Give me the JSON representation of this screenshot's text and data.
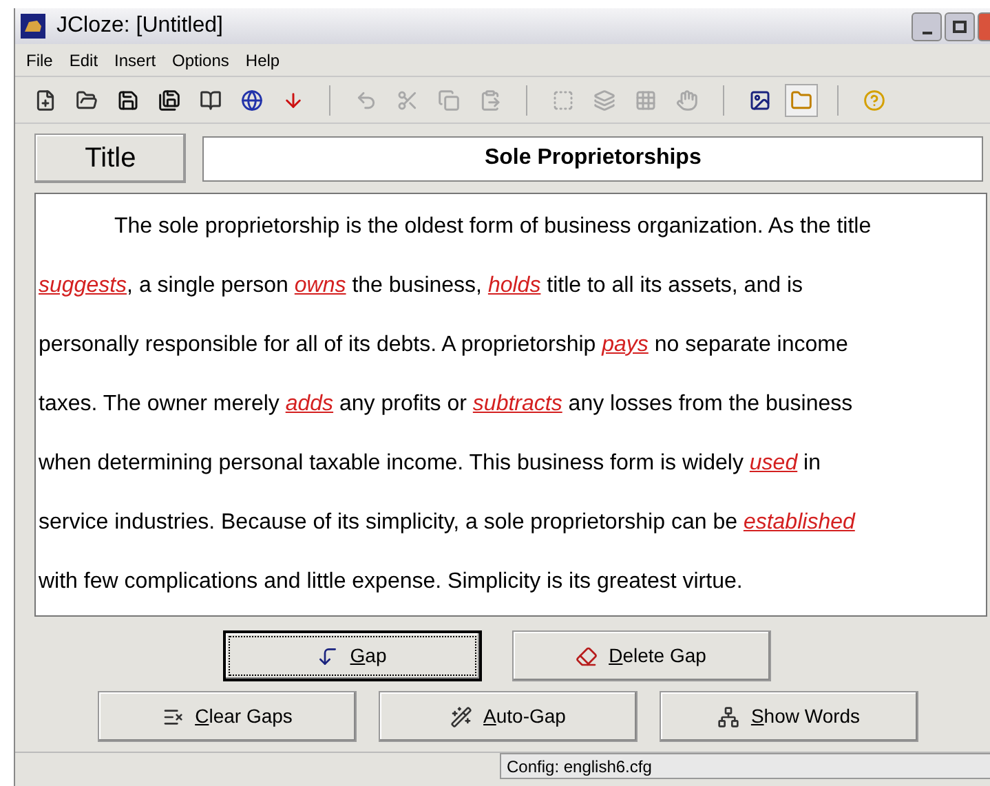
{
  "window": {
    "title": "JCloze: [Untitled]"
  },
  "menu": [
    "File",
    "Edit",
    "Insert",
    "Options",
    "Help"
  ],
  "toolbar": [
    {
      "kind": "new",
      "disabled": false,
      "pressed": false
    },
    {
      "kind": "open",
      "disabled": false,
      "pressed": false
    },
    {
      "kind": "save",
      "disabled": false,
      "pressed": false
    },
    {
      "kind": "saveas",
      "disabled": false,
      "pressed": false
    },
    {
      "kind": "book",
      "disabled": false,
      "pressed": false
    },
    {
      "kind": "web",
      "disabled": false,
      "pressed": false
    },
    {
      "kind": "down",
      "disabled": false,
      "pressed": false
    },
    {
      "kind": "sep"
    },
    {
      "kind": "undo",
      "disabled": true,
      "pressed": false
    },
    {
      "kind": "cut",
      "disabled": true,
      "pressed": false
    },
    {
      "kind": "copy",
      "disabled": true,
      "pressed": false
    },
    {
      "kind": "paste",
      "disabled": true,
      "pressed": false
    },
    {
      "kind": "sep"
    },
    {
      "kind": "gap",
      "disabled": true,
      "pressed": false
    },
    {
      "kind": "layers",
      "disabled": true,
      "pressed": false
    },
    {
      "kind": "grid",
      "disabled": true,
      "pressed": false
    },
    {
      "kind": "hand",
      "disabled": true,
      "pressed": false
    },
    {
      "kind": "sep"
    },
    {
      "kind": "image",
      "disabled": false,
      "pressed": false
    },
    {
      "kind": "folder",
      "disabled": false,
      "pressed": true
    },
    {
      "kind": "sep"
    },
    {
      "kind": "help",
      "disabled": false,
      "pressed": false
    }
  ],
  "title_label": "Title",
  "title_value": "Sole Proprietorships",
  "passage": [
    [
      {
        "text": "The sole proprietorship is the oldest form of business organization. As the title",
        "gap": false
      }
    ],
    [
      {
        "text": "suggests",
        "gap": true
      },
      {
        "text": ", a single person ",
        "gap": false
      },
      {
        "text": "owns",
        "gap": true
      },
      {
        "text": " the business, ",
        "gap": false
      },
      {
        "text": "holds",
        "gap": true
      },
      {
        "text": " title to all its assets, and is",
        "gap": false
      }
    ],
    [
      {
        "text": "personally responsible for all of its debts. A proprietorship ",
        "gap": false
      },
      {
        "text": "pays",
        "gap": true
      },
      {
        "text": " no separate income",
        "gap": false
      }
    ],
    [
      {
        "text": "taxes. The owner merely ",
        "gap": false
      },
      {
        "text": "adds",
        "gap": true
      },
      {
        "text": " any profits or ",
        "gap": false
      },
      {
        "text": "subtracts",
        "gap": true
      },
      {
        "text": " any losses from the business",
        "gap": false
      }
    ],
    [
      {
        "text": "when determining personal taxable income. This business form is widely ",
        "gap": false
      },
      {
        "text": "used",
        "gap": true
      },
      {
        "text": " in",
        "gap": false
      }
    ],
    [
      {
        "text": "service industries. Because of its simplicity, a sole proprietorship can be ",
        "gap": false
      },
      {
        "text": "established",
        "gap": true
      }
    ],
    [
      {
        "text": "with few complications and little expense. Simplicity is its greatest virtue.",
        "gap": false
      }
    ]
  ],
  "buttons_row1": [
    {
      "kind": "gap",
      "accel": "G",
      "rest": "ap",
      "focused": true
    },
    {
      "kind": "delete",
      "accel": "D",
      "rest": "elete Gap",
      "focused": false
    }
  ],
  "buttons_row2": [
    {
      "kind": "clear",
      "accel": "C",
      "rest": "lear Gaps",
      "focused": false
    },
    {
      "kind": "auto",
      "accel": "A",
      "rest": "uto-Gap",
      "focused": false
    },
    {
      "kind": "words",
      "accel": "S",
      "rest": "how Words",
      "focused": false
    }
  ],
  "status_bar": "Config: english6.cfg"
}
